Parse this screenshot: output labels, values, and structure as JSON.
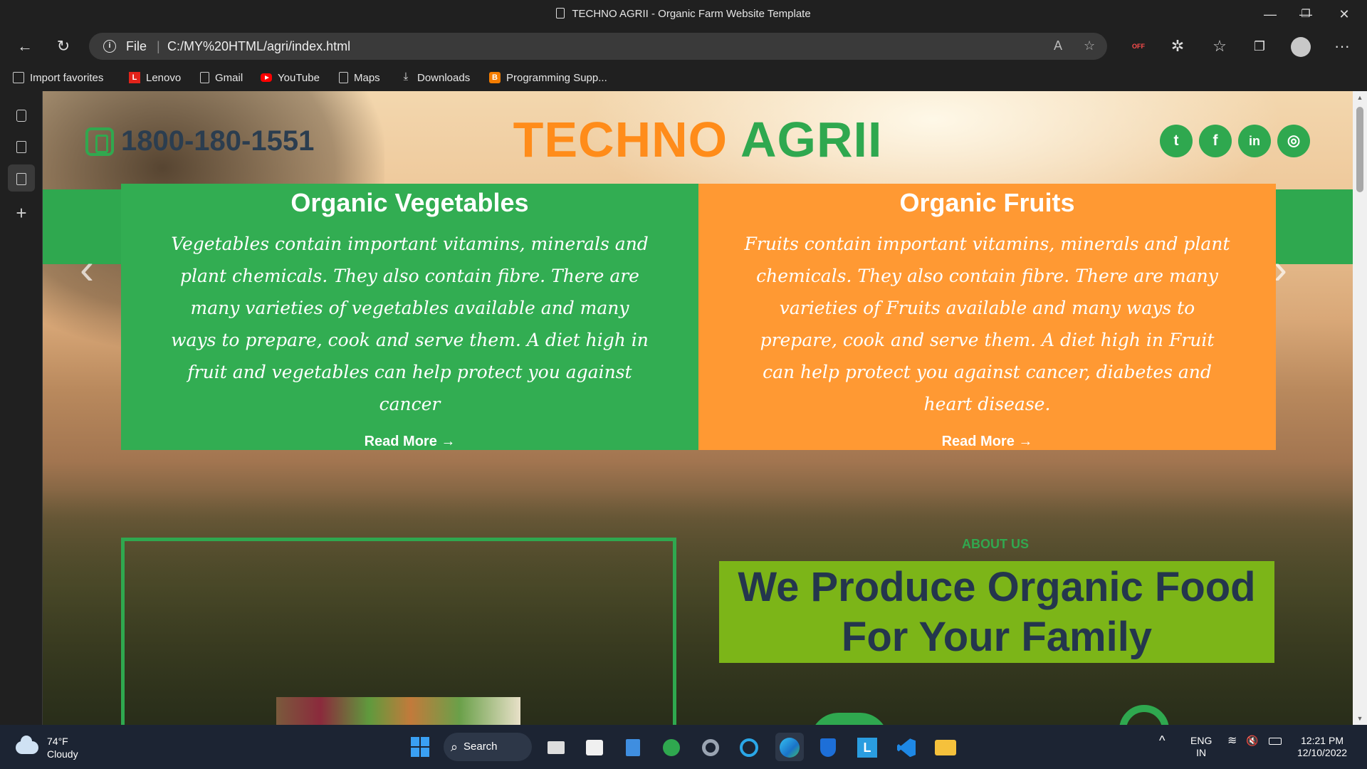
{
  "window": {
    "title": "TECHNO AGRII - Organic Farm Website Template",
    "minimize": "—",
    "restore": "❐",
    "close": "✕"
  },
  "toolbar": {
    "back": "←",
    "refresh": "↻",
    "info": "i",
    "file_label": "File",
    "separator": "|",
    "url": "C:/MY%20HTML/agri/index.html",
    "read_aloud": "A",
    "fav_add": "☆",
    "adblock": "OFF",
    "extensions": "✲",
    "favorites": "☆",
    "collections": "❐",
    "more": "···"
  },
  "bookmarks": [
    {
      "label": "Import favorites",
      "icon": "import-icon"
    },
    {
      "label": "Lenovo",
      "icon": "lenovo-icon"
    },
    {
      "label": "Gmail",
      "icon": "page-icon"
    },
    {
      "label": "YouTube",
      "icon": "youtube-icon"
    },
    {
      "label": "Maps",
      "icon": "page-icon"
    },
    {
      "label": "Downloads",
      "icon": "download-icon"
    },
    {
      "label": "Programming Supp...",
      "icon": "blogger-icon"
    }
  ],
  "sidepanel": {
    "add": "+"
  },
  "site": {
    "phone": "1800-180-1551",
    "logo_part1": "TECHNO",
    "logo_part2": "AGRII",
    "socials": [
      {
        "label": "t",
        "name": "twitter"
      },
      {
        "label": "f",
        "name": "facebook"
      },
      {
        "label": "in",
        "name": "linkedin"
      },
      {
        "label": "◎",
        "name": "instagram"
      }
    ],
    "slider_prev": "‹",
    "slider_next": "›",
    "cards": [
      {
        "title": "Organic Vegetables",
        "text": "Vegetables contain important vitamins, minerals and plant chemicals. They also contain fibre. There are many varieties of vegetables available and many ways to prepare, cook and serve them. A diet high in fruit and vegetables can help protect you against cancer",
        "read_more": "Read More →",
        "color": "#32ad52"
      },
      {
        "title": "Organic Fruits",
        "text": "Fruits contain important vitamins, minerals and plant chemicals. They also contain fibre. There are many varieties of Fruits available and many ways to prepare, cook and serve them. A diet high in Fruit can help protect you against cancer, diabetes and heart disease.",
        "read_more": "Read More →",
        "color": "#ff9933"
      }
    ],
    "about_label": "ABOUT US",
    "about_heading": "We Produce Organic Food For Your Family",
    "colors": {
      "green": "#2fa84f",
      "orange": "#ff8c1a",
      "lime": "#7cb518",
      "navy": "#24364d"
    }
  },
  "taskbar": {
    "temp": "74°F",
    "condition": "Cloudy",
    "search": "Search",
    "lang": "ENG",
    "region": "IN",
    "time": "12:21 PM",
    "date": "12/10/2022",
    "tray_up": "^",
    "volume": "🔇"
  }
}
